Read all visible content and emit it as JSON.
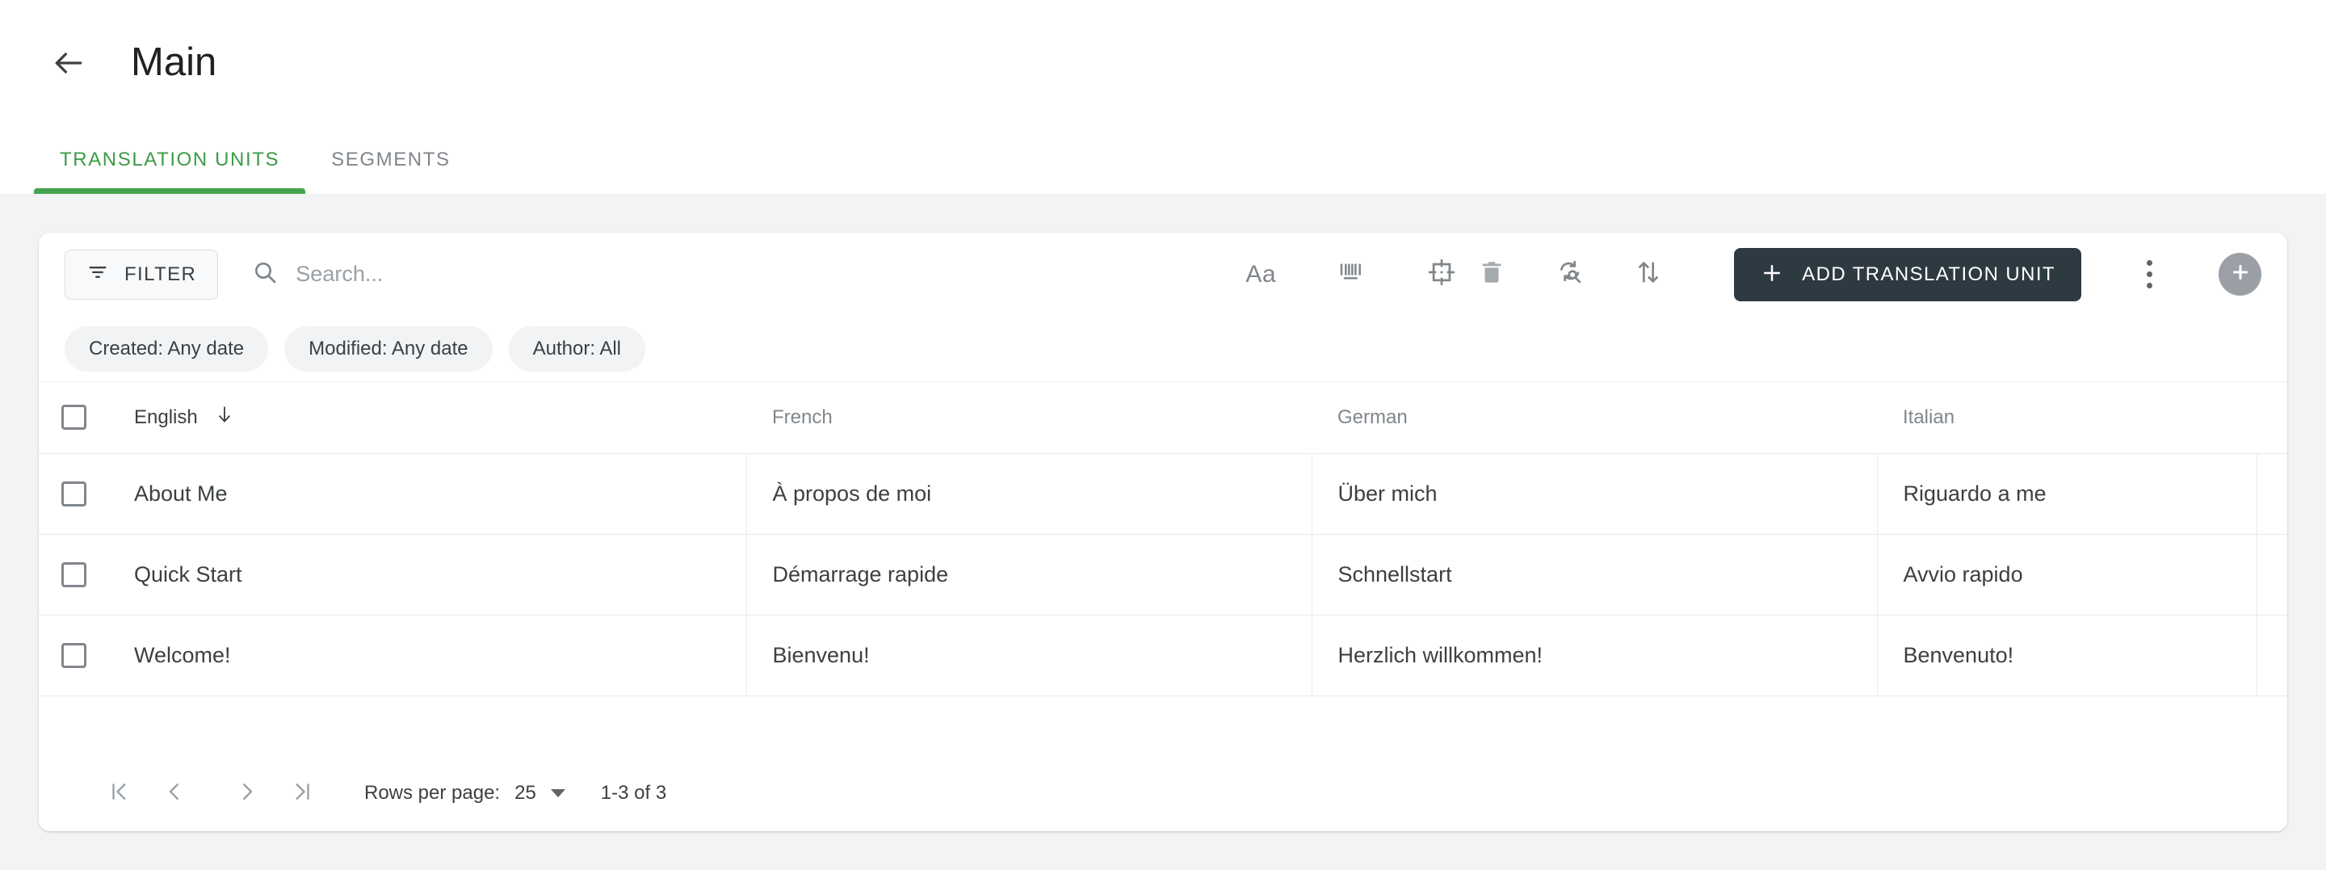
{
  "header": {
    "back_icon": "arrow-left-icon",
    "title": "Main"
  },
  "tabs": [
    {
      "label": "TRANSLATION UNITS",
      "active": true
    },
    {
      "label": "SEGMENTS",
      "active": false
    }
  ],
  "toolbar": {
    "filter_label": "FILTER",
    "filter_icon": "filter-icon",
    "search_icon": "search-icon",
    "search_value": "",
    "search_placeholder": "Search...",
    "match_case_label": "Aa",
    "barcode_icon": "barcode-icon",
    "selection_icon": "selection-target-icon",
    "delete_icon": "trash-icon",
    "find_replace_icon": "find-replace-icon",
    "sort_icon": "sort-arrows-icon",
    "add_unit_label": "ADD TRANSLATION UNIT",
    "add_unit_plus": "plus-icon",
    "more_icon": "more-vertical-icon",
    "fab_icon": "add-circle-icon"
  },
  "chips": [
    {
      "label": "Created: Any date"
    },
    {
      "label": "Modified: Any date"
    },
    {
      "label": "Author: All"
    }
  ],
  "table": {
    "select_all_checked": false,
    "sort_column": "English",
    "sort_direction_icon": "arrow-down-icon",
    "columns": [
      {
        "label": "English"
      },
      {
        "label": "French"
      },
      {
        "label": "German"
      },
      {
        "label": "Italian"
      }
    ],
    "rows": [
      {
        "checked": false,
        "english": "About Me",
        "french": "À propos de moi",
        "german": "Über mich",
        "italian": "Riguardo a me"
      },
      {
        "checked": false,
        "english": "Quick Start",
        "french": "Démarrage rapide",
        "german": "Schnellstart",
        "italian": "Avvio rapido"
      },
      {
        "checked": false,
        "english": "Welcome!",
        "french": "Bienvenu!",
        "german": "Herzlich willkommen!",
        "italian": "Benvenuto!"
      }
    ]
  },
  "paginator": {
    "first_icon": "first-page-icon",
    "prev_icon": "prev-page-icon",
    "next_icon": "next-page-icon",
    "last_icon": "last-page-icon",
    "rows_per_page_label": "Rows per page:",
    "rows_per_page_value": "25",
    "range_label": "1-3 of 3"
  },
  "colors": {
    "accent_green": "#44a34e",
    "button_dark": "#2e3a42",
    "page_bg": "#f1f3f4",
    "text_primary": "#3c4043",
    "text_muted": "#80868b"
  }
}
